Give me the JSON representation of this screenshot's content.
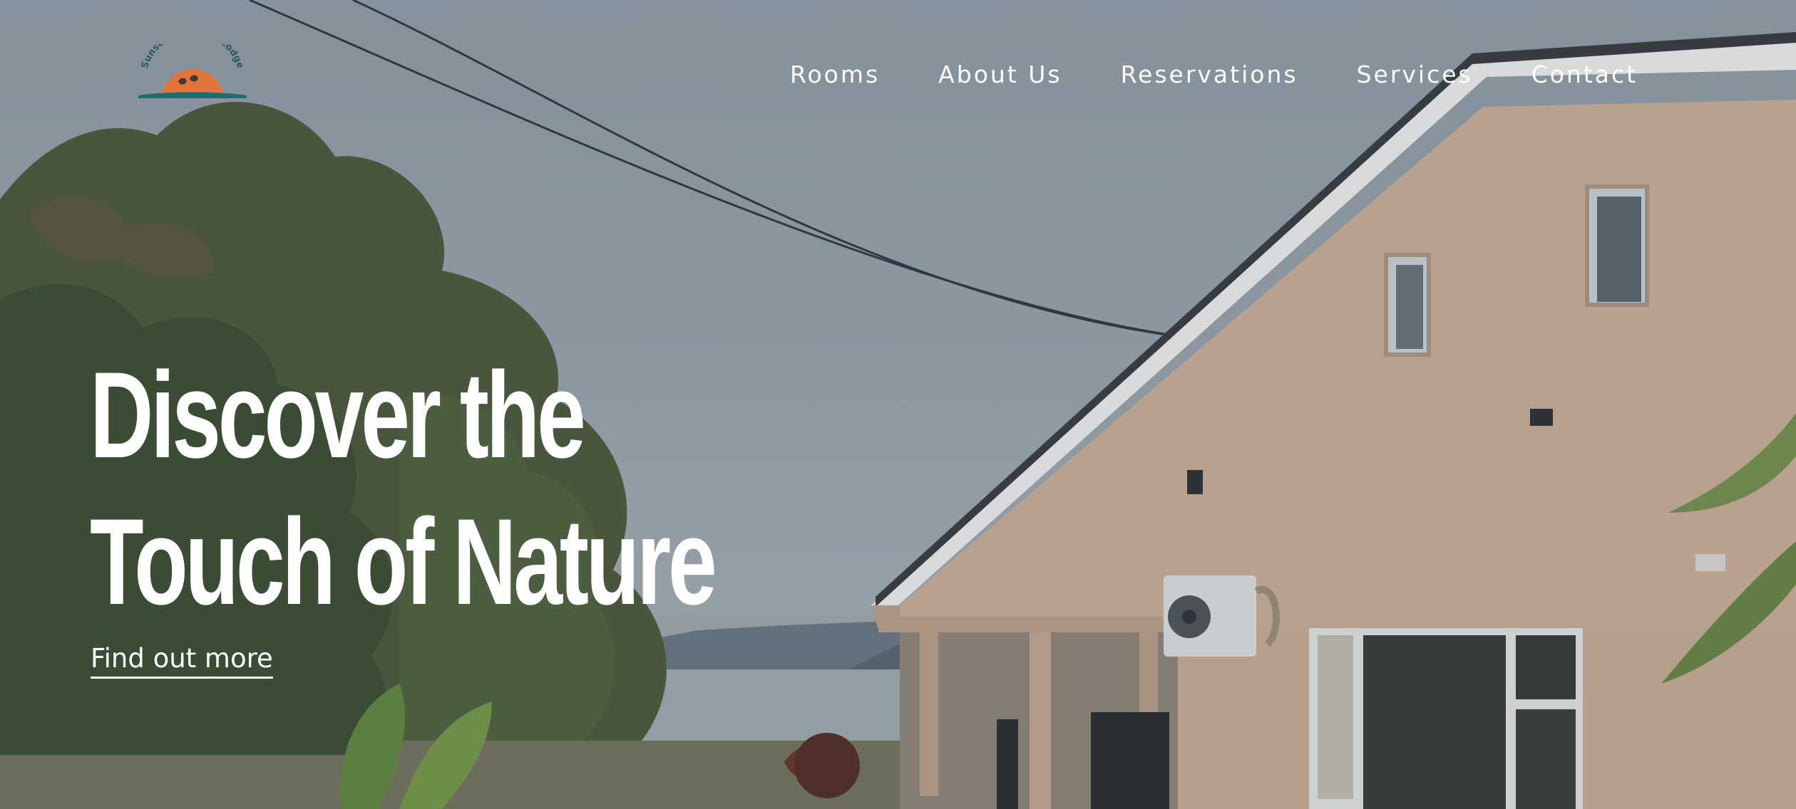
{
  "brand": {
    "name": "Sunset Lakeview Lodge",
    "colors": {
      "sun": "#e0743a",
      "water": "#1f6b6e",
      "text": "#2a5a5c"
    }
  },
  "nav": {
    "items": [
      {
        "label": "Rooms"
      },
      {
        "label": "About Us"
      },
      {
        "label": "Reservations"
      },
      {
        "label": "Services"
      },
      {
        "label": "Contact"
      }
    ]
  },
  "hero": {
    "headline_line1": "Discover the",
    "headline_line2": "Touch of Nature",
    "cta_label": "Find out more"
  }
}
